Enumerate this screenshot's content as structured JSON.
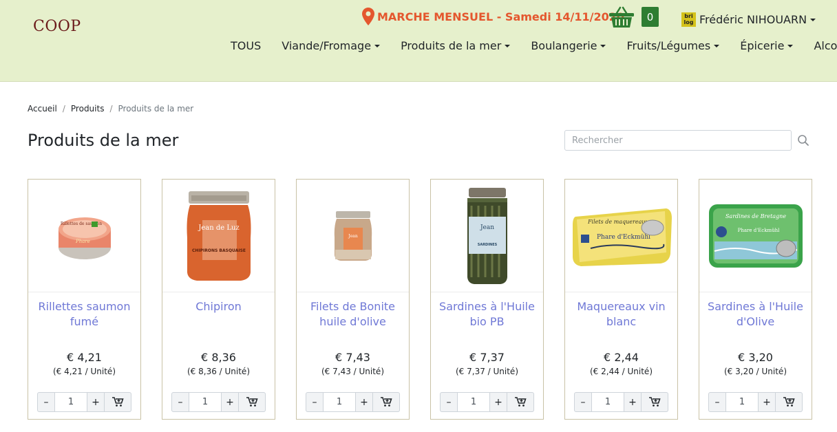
{
  "header": {
    "logo": "COOP",
    "market_label": "MARCHE MENSUEL - Samedi 14/11/2020",
    "cart_count": "0",
    "user_badge": "bri log",
    "user_name": "Frédéric NIHOUARN",
    "accent_color": "#e4572e",
    "header_bg": "#e6f0cc"
  },
  "nav": {
    "items": [
      {
        "label": "TOUS",
        "dropdown": false
      },
      {
        "label": "Viande/Fromage",
        "dropdown": true
      },
      {
        "label": "Produits de la mer",
        "dropdown": true
      },
      {
        "label": "Boulangerie",
        "dropdown": true
      },
      {
        "label": "Fruits/Légumes",
        "dropdown": true
      },
      {
        "label": "Épicerie",
        "dropdown": true
      },
      {
        "label": "Alcools",
        "dropdown": true
      }
    ]
  },
  "breadcrumb": {
    "home": "Accueil",
    "products": "Produits",
    "current": "Produits de la mer"
  },
  "page": {
    "title": "Produits de la mer",
    "search_placeholder": "Rechercher"
  },
  "products": [
    {
      "name": "Rillettes saumon fumé",
      "price": "€ 4,21",
      "unit_price": "(€ 4,21 / Unité)",
      "qty": "1",
      "image": "tin-rillettes"
    },
    {
      "name": "Chipiron",
      "price": "€ 8,36",
      "unit_price": "(€ 8,36 / Unité)",
      "qty": "1",
      "image": "jar-chipiron"
    },
    {
      "name": "Filets de Bonite huile d'olive",
      "price": "€ 7,43",
      "unit_price": "(€ 7,43 / Unité)",
      "qty": "1",
      "image": "jar-bonite"
    },
    {
      "name": "Sardines à l'Huile bio PB",
      "price": "€ 7,37",
      "unit_price": "(€ 7,37 / Unité)",
      "qty": "1",
      "image": "jar-sardines"
    },
    {
      "name": "Maquereaux vin blanc",
      "price": "€ 2,44",
      "unit_price": "(€ 2,44 / Unité)",
      "qty": "1",
      "image": "tin-maquereaux"
    },
    {
      "name": "Sardines à l'Huile d'Olive",
      "price": "€ 3,20",
      "unit_price": "(€ 3,20 / Unité)",
      "qty": "1",
      "image": "tin-sardines"
    }
  ],
  "controls": {
    "minus": "–",
    "plus": "+"
  },
  "image_text": {
    "rillettes_label": "Rillettes de saumon",
    "jean_de_luz": "Jean de Luz",
    "chipirons": "CHIPIRONS BASQUAISE",
    "maquereaux_label": "Filets de maquereaux",
    "phare": "Phare d'Eckmühl",
    "sardines_label": "Sardines de Bretagne"
  }
}
